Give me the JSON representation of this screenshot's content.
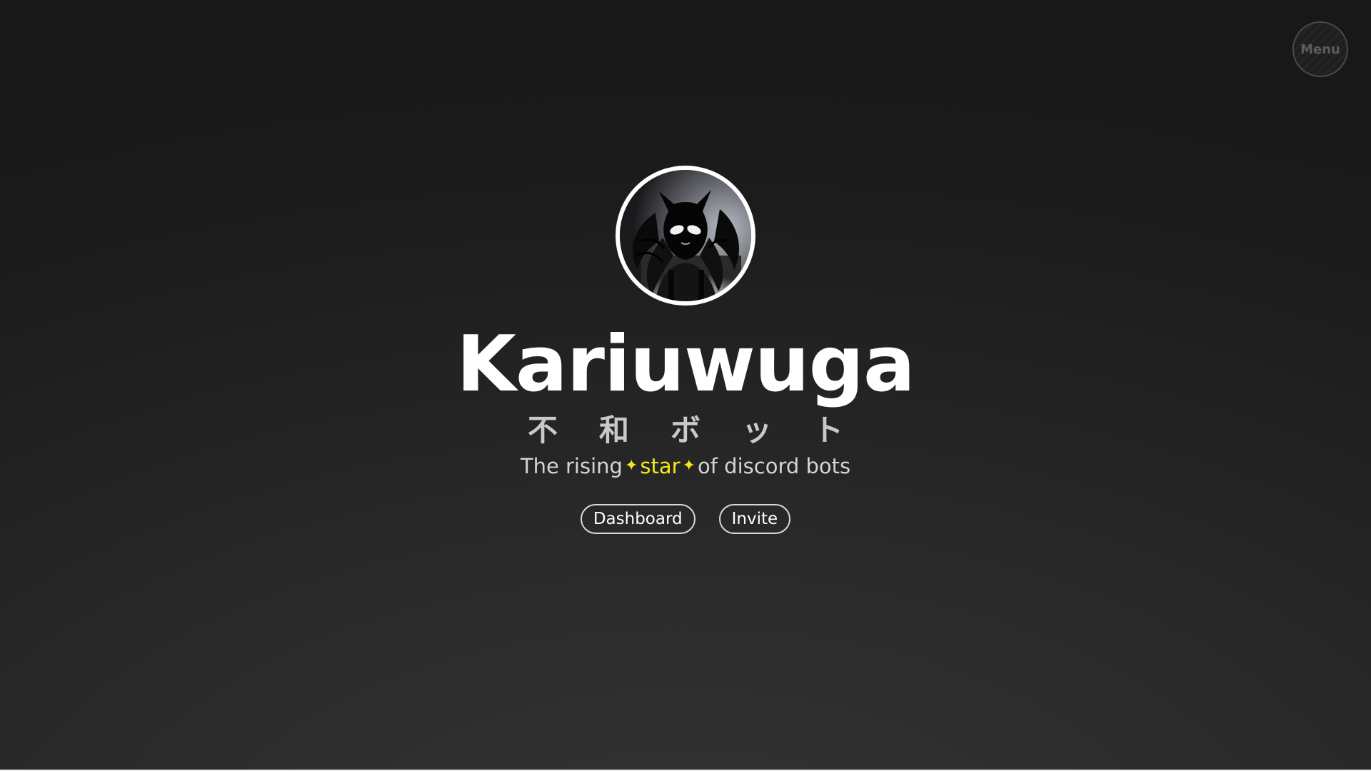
{
  "menu": {
    "label": "Menu"
  },
  "avatar": {
    "alt": "Kariuwuga avatar"
  },
  "hero": {
    "title": "Kariuwuga",
    "subtitle_jp": "不和ボット",
    "tagline_prefix": "The rising",
    "tagline_sparkle_icon": "✦",
    "tagline_highlight": "star",
    "tagline_suffix": "of discord bots"
  },
  "buttons": {
    "dashboard_label": "Dashboard",
    "invite_label": "Invite"
  },
  "colors": {
    "highlight": "#f5e71c",
    "background_dark": "#181818",
    "background_light": "#353535",
    "text": "#ffffff"
  }
}
